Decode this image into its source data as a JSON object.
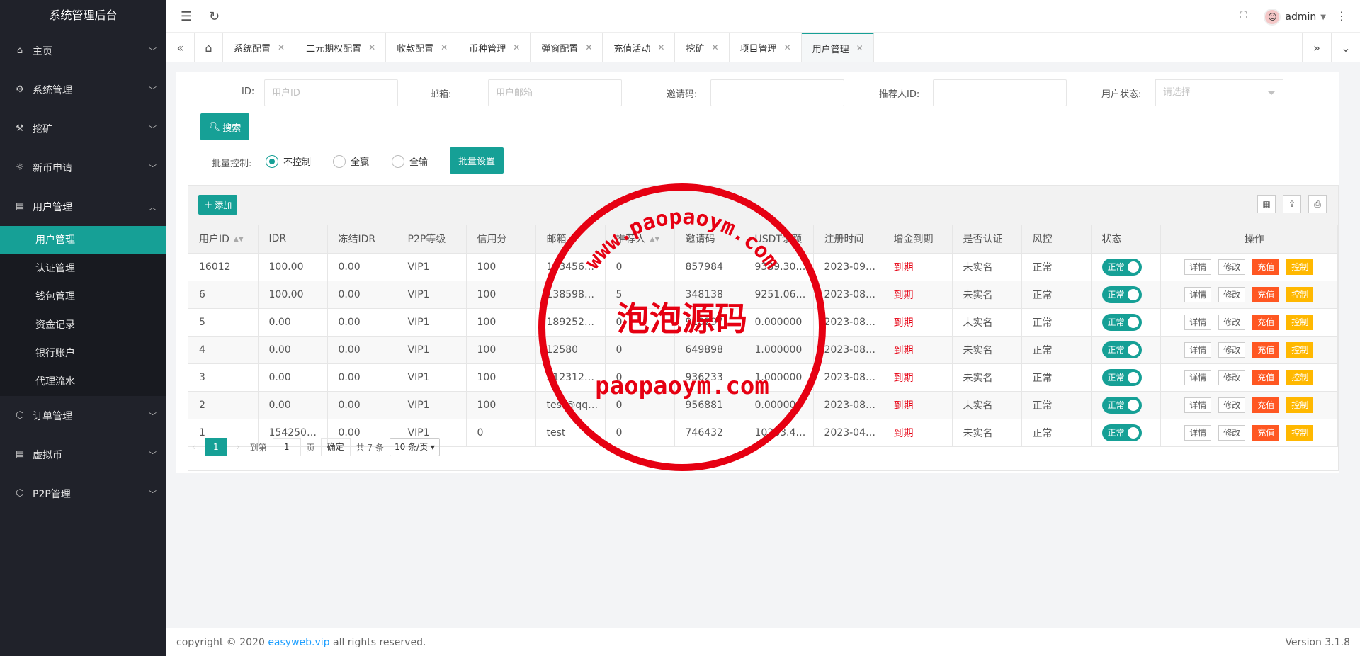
{
  "app_title": "系统管理后台",
  "sidebar": {
    "items": [
      {
        "label": "主页",
        "icon": "home-icon"
      },
      {
        "label": "系统管理",
        "icon": "settings-icon"
      },
      {
        "label": "挖矿",
        "icon": "mining-icon"
      },
      {
        "label": "新币申请",
        "icon": "coin-icon"
      },
      {
        "label": "用户管理",
        "icon": "user-icon",
        "open": true
      },
      {
        "label": "订单管理",
        "icon": "order-icon"
      },
      {
        "label": "虚拟币",
        "icon": "currency-icon"
      },
      {
        "label": "P2P管理",
        "icon": "p2p-icon"
      }
    ],
    "sub_items": [
      {
        "label": "用户管理",
        "active": true
      },
      {
        "label": "认证管理"
      },
      {
        "label": "钱包管理"
      },
      {
        "label": "资金记录"
      },
      {
        "label": "银行账户"
      },
      {
        "label": "代理流水"
      }
    ]
  },
  "header": {
    "user_name": "admin"
  },
  "tabs": [
    {
      "label": "系统配置"
    },
    {
      "label": "二元期权配置"
    },
    {
      "label": "收款配置"
    },
    {
      "label": "币种管理"
    },
    {
      "label": "弹窗配置"
    },
    {
      "label": "充值活动"
    },
    {
      "label": "挖矿"
    },
    {
      "label": "项目管理"
    },
    {
      "label": "用户管理",
      "active": true
    }
  ],
  "filters": {
    "id_label": "ID:",
    "id_placeholder": "用户ID",
    "email_label": "邮箱:",
    "email_placeholder": "用户邮箱",
    "invite_label": "邀请码:",
    "referrer_label": "推荐人ID:",
    "status_label": "用户状态:",
    "status_placeholder": "请选择",
    "search_button": "搜索",
    "batch_label": "批量控制:",
    "radio_options": [
      "不控制",
      "全赢",
      "全输"
    ],
    "radio_selected": "不控制",
    "batch_button": "批量设置"
  },
  "table": {
    "add_button": "添加",
    "columns": [
      "用户ID",
      "IDR",
      "冻结IDR",
      "P2P等级",
      "信用分",
      "邮箱",
      "推荐人",
      "邀请码",
      "USDT余额",
      "注册时间",
      "增金到期",
      "是否认证",
      "风控",
      "状态",
      "操作"
    ],
    "rows": [
      [
        "16012",
        "100.00",
        "0.00",
        "VIP1",
        "100",
        "123456…",
        "0",
        "857984",
        "9389.30…",
        "2023-09…",
        "到期",
        "未实名",
        "正常"
      ],
      [
        "6",
        "100.00",
        "0.00",
        "VIP1",
        "100",
        "138598…",
        "5",
        "348138",
        "9251.06…",
        "2023-08…",
        "到期",
        "未实名",
        "正常"
      ],
      [
        "5",
        "0.00",
        "0.00",
        "VIP1",
        "100",
        "189252…",
        "0",
        "910297",
        "0.000000",
        "2023-08…",
        "到期",
        "未实名",
        "正常"
      ],
      [
        "4",
        "0.00",
        "0.00",
        "VIP1",
        "100",
        "12580",
        "0",
        "649898",
        "1.000000",
        "2023-08…",
        "到期",
        "未实名",
        "正常"
      ],
      [
        "3",
        "0.00",
        "0.00",
        "VIP1",
        "100",
        "312312…",
        "0",
        "936233",
        "1.000000",
        "2023-08…",
        "到期",
        "未实名",
        "正常"
      ],
      [
        "2",
        "0.00",
        "0.00",
        "VIP1",
        "100",
        "test@qq…",
        "0",
        "956881",
        "0.000000",
        "2023-08…",
        "到期",
        "未实名",
        "正常"
      ],
      [
        "1",
        "154250…",
        "0.00",
        "VIP1",
        "0",
        "test",
        "0",
        "746432",
        "10283.4…",
        "2023-04…",
        "到期",
        "未实名",
        "正常"
      ]
    ],
    "status_text": "正常",
    "actions": [
      "详情",
      "修改",
      "充值",
      "控制"
    ]
  },
  "pager": {
    "current": "1",
    "goto_label": "到第",
    "goto_value": "1",
    "page_unit": "页",
    "confirm": "确定",
    "total": "共 7 条",
    "page_size": "10 条/页"
  },
  "footer": {
    "copyright_pre": "copyright © 2020 ",
    "link": "easyweb.vip",
    "copyright_post": " all rights reserved.",
    "version": "Version 3.1.8"
  },
  "watermark": {
    "arc_text": "www.paopaoym.com",
    "center_text": "泡泡源码",
    "bottom_text": "paopaoym.com",
    "color": "#e60012"
  },
  "colors": {
    "accent": "#16a096",
    "sidebar_bg": "#20222a",
    "danger": "#e60012",
    "warn": "#ffb800",
    "orange": "#ff5722"
  }
}
